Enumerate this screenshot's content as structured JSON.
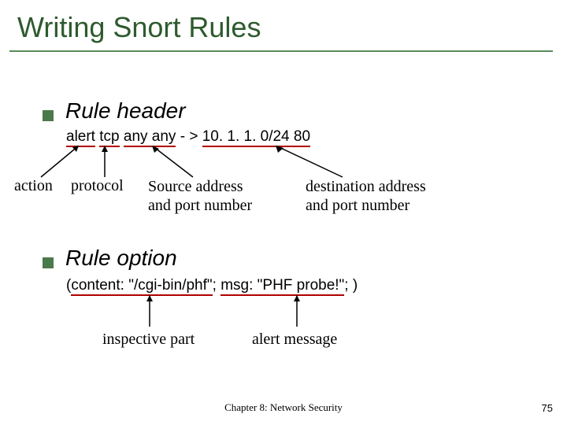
{
  "title": "Writing Snort Rules",
  "section1": {
    "heading": "Rule header",
    "rule_parts": {
      "action": "alert",
      "protocol": "tcp",
      "src": "any any",
      "arrow": "- >",
      "dst": "10. 1. 1. 0/24 80"
    },
    "labels": {
      "action": "action",
      "protocol": "protocol",
      "source": "Source address\nand port number",
      "dest": "destination address\nand port number"
    }
  },
  "section2": {
    "heading": "Rule option",
    "rule_parts": {
      "open": "(",
      "content": "content: \"/cgi-bin/phf\"",
      "sep": "; ",
      "msg": "msg: \"PHF probe!\"",
      "close": "; )"
    },
    "labels": {
      "inspective": "inspective part",
      "alertmsg": "alert message"
    }
  },
  "footer": "Chapter 8: Network Security",
  "page": "75"
}
